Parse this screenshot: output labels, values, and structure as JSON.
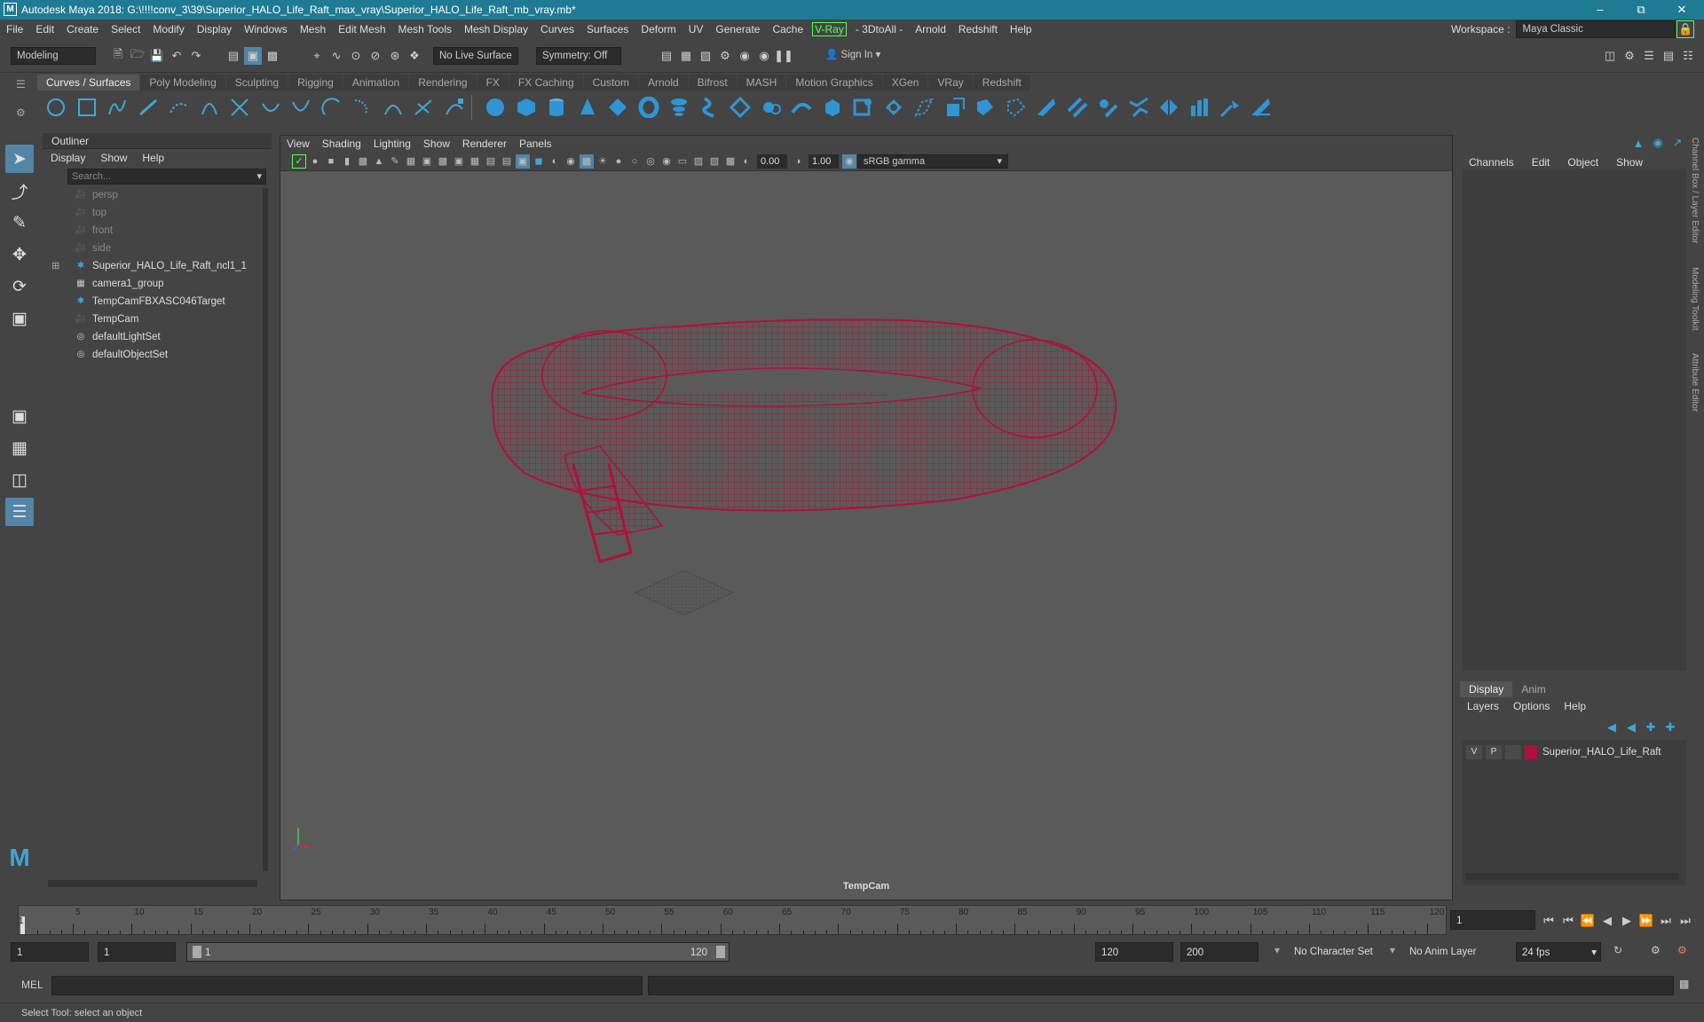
{
  "title": "Autodesk Maya 2018: G:\\!!!!conv_3\\39\\Superior_HALO_Life_Raft_max_vray\\Superior_HALO_Life_Raft_mb_vray.mb*",
  "menus": [
    "File",
    "Edit",
    "Create",
    "Select",
    "Modify",
    "Display",
    "Windows",
    "Mesh",
    "Edit Mesh",
    "Mesh Tools",
    "Mesh Display",
    "Curves",
    "Surfaces",
    "Deform",
    "UV",
    "Generate",
    "Cache"
  ],
  "menus_vray": "V-Ray",
  "menus_tail": [
    "- 3DtoAll -",
    "Arnold",
    "Redshift",
    "Help"
  ],
  "workspace_label": "Workspace :",
  "workspace_value": "Maya Classic",
  "mode": "Modeling",
  "live_surface": "No Live Surface",
  "symmetry": "Symmetry: Off",
  "sign_in": "Sign In",
  "shelf_tabs": [
    "Curves / Surfaces",
    "Poly Modeling",
    "Sculpting",
    "Rigging",
    "Animation",
    "Rendering",
    "FX",
    "FX Caching",
    "Custom",
    "Arnold",
    "Bifrost",
    "MASH",
    "Motion Graphics",
    "XGen",
    "VRay",
    "Redshift"
  ],
  "outliner": {
    "title": "Outliner",
    "menu": [
      "Display",
      "Show",
      "Help"
    ],
    "search_placeholder": "Search...",
    "items": [
      {
        "label": "persp",
        "icon": "camera-icon",
        "dim": true
      },
      {
        "label": "top",
        "icon": "camera-icon",
        "dim": true
      },
      {
        "label": "front",
        "icon": "camera-icon",
        "dim": true
      },
      {
        "label": "side",
        "icon": "camera-icon",
        "dim": true
      },
      {
        "label": "Superior_HALO_Life_Raft_ncl1_1",
        "icon": "transform-icon",
        "dim": false,
        "expand": true
      },
      {
        "label": "camera1_group",
        "icon": "group-icon",
        "dim": false
      },
      {
        "label": "TempCamFBXASC046Target",
        "icon": "transform-icon",
        "dim": false
      },
      {
        "label": "TempCam",
        "icon": "camera-icon",
        "dim": false
      },
      {
        "label": "defaultLightSet",
        "icon": "set-icon",
        "dim": false
      },
      {
        "label": "defaultObjectSet",
        "icon": "set-icon",
        "dim": false
      }
    ]
  },
  "viewport": {
    "menu": [
      "View",
      "Shading",
      "Lighting",
      "Show",
      "Renderer",
      "Panels"
    ],
    "exposure": "0.00",
    "gamma": "1.00",
    "colorspace": "sRGB gamma",
    "camera_label": "TempCam",
    "wire_color": "#b0103c"
  },
  "channel_box": {
    "menu": [
      "Channels",
      "Edit",
      "Object",
      "Show"
    ]
  },
  "side_tabs": [
    "Channel Box / Layer Editor",
    "Modeling Toolkit",
    "Attribute Editor"
  ],
  "layers": {
    "tabs": [
      "Display",
      "Anim"
    ],
    "menu": [
      "Layers",
      "Options",
      "Help"
    ],
    "row": {
      "v": "V",
      "p": "P",
      "name": "Superior_HALO_Life_Raft",
      "color": "#b0103c"
    }
  },
  "timeline": {
    "ticks": [
      "5",
      "10",
      "15",
      "20",
      "25",
      "30",
      "35",
      "40",
      "45",
      "50",
      "55",
      "60",
      "65",
      "70",
      "75",
      "80",
      "85",
      "90",
      "95",
      "100",
      "105",
      "110",
      "115",
      "120"
    ],
    "current": "1",
    "current_field": "1"
  },
  "range": {
    "start": "1",
    "start2": "1",
    "slider_start": "1",
    "slider_end": "120",
    "end": "120",
    "end2": "200",
    "char_set": "No Character Set",
    "anim_layer": "No Anim Layer",
    "fps": "24 fps"
  },
  "cmd": {
    "label": "MEL"
  },
  "help_line": "Select Tool: select an object"
}
